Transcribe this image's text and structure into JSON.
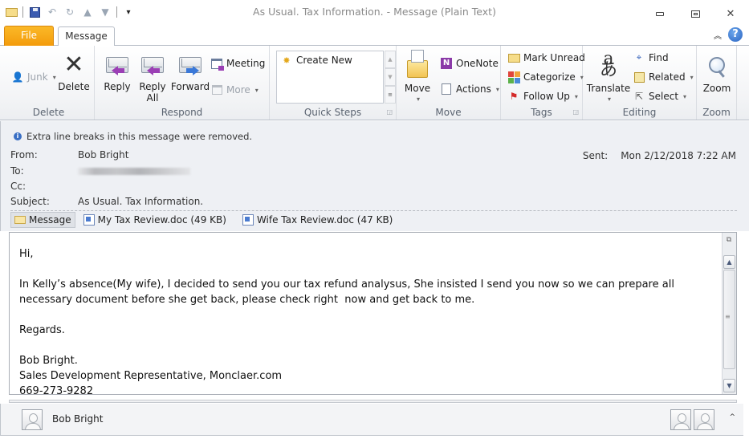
{
  "window": {
    "title": "As Usual. Tax Information.  -  Message (Plain Text)",
    "controls": {
      "minimize": "▭",
      "restore": "▣",
      "close": "✕"
    }
  },
  "quick_access": {
    "items": [
      {
        "name": "mail-icon"
      },
      {
        "name": "save-icon"
      },
      {
        "name": "undo-icon"
      },
      {
        "name": "redo-icon"
      },
      {
        "name": "previous-item-icon"
      },
      {
        "name": "next-item-icon"
      },
      {
        "name": "customize-qat-icon"
      }
    ]
  },
  "tabs": {
    "file": "File",
    "message": "Message",
    "help": "?",
    "collapse": "^"
  },
  "ribbon": {
    "delete_group": {
      "label": "Delete",
      "junk": "Junk",
      "delete": "Delete"
    },
    "respond_group": {
      "label": "Respond",
      "reply": "Reply",
      "reply_all_line1": "Reply",
      "reply_all_line2": "All",
      "forward": "Forward",
      "meeting": "Meeting",
      "more": "More"
    },
    "quick_steps_group": {
      "label": "Quick Steps",
      "create_new": "Create New"
    },
    "move_group": {
      "label": "Move",
      "move": "Move",
      "onenote": "OneNote",
      "actions": "Actions"
    },
    "tags_group": {
      "label": "Tags",
      "mark_unread": "Mark Unread",
      "categorize": "Categorize",
      "follow_up": "Follow Up"
    },
    "editing_group": {
      "label": "Editing",
      "translate": "Translate",
      "find": "Find",
      "related": "Related",
      "select": "Select"
    },
    "zoom_group": {
      "label": "Zoom",
      "zoom": "Zoom"
    }
  },
  "header": {
    "info": "Extra line breaks in this message were removed.",
    "from_label": "From:",
    "from_value": "Bob Bright",
    "to_label": "To:",
    "cc_label": "Cc:",
    "subject_label": "Subject:",
    "subject_value": "As Usual. Tax Information.",
    "sent_label": "Sent:",
    "sent_value": "Mon 2/12/2018 7:22 AM"
  },
  "attachments": [
    {
      "label": "Message",
      "type": "message"
    },
    {
      "label": "My Tax Review.doc (49 KB)",
      "type": "doc"
    },
    {
      "label": "Wife Tax Review.doc (47 KB)",
      "type": "doc"
    }
  ],
  "body": {
    "text": "Hi,\n\nIn Kelly’s absence(My wife), I decided to send you our tax refund analysus, She insisted I send you now so we can prepare all\nnecessary document before she get back, please check right  now and get back to me.\n\nRegards.\n\nBob Bright.\nSales Development Representative, Monclaer.com\n669-273-9282"
  },
  "people_pane": {
    "name": "Bob Bright",
    "toggle": "^"
  },
  "colors": {
    "file_tab": "#f39b0b",
    "header_bg": "#eef0f4",
    "info_icon": "#3a6fc4"
  }
}
